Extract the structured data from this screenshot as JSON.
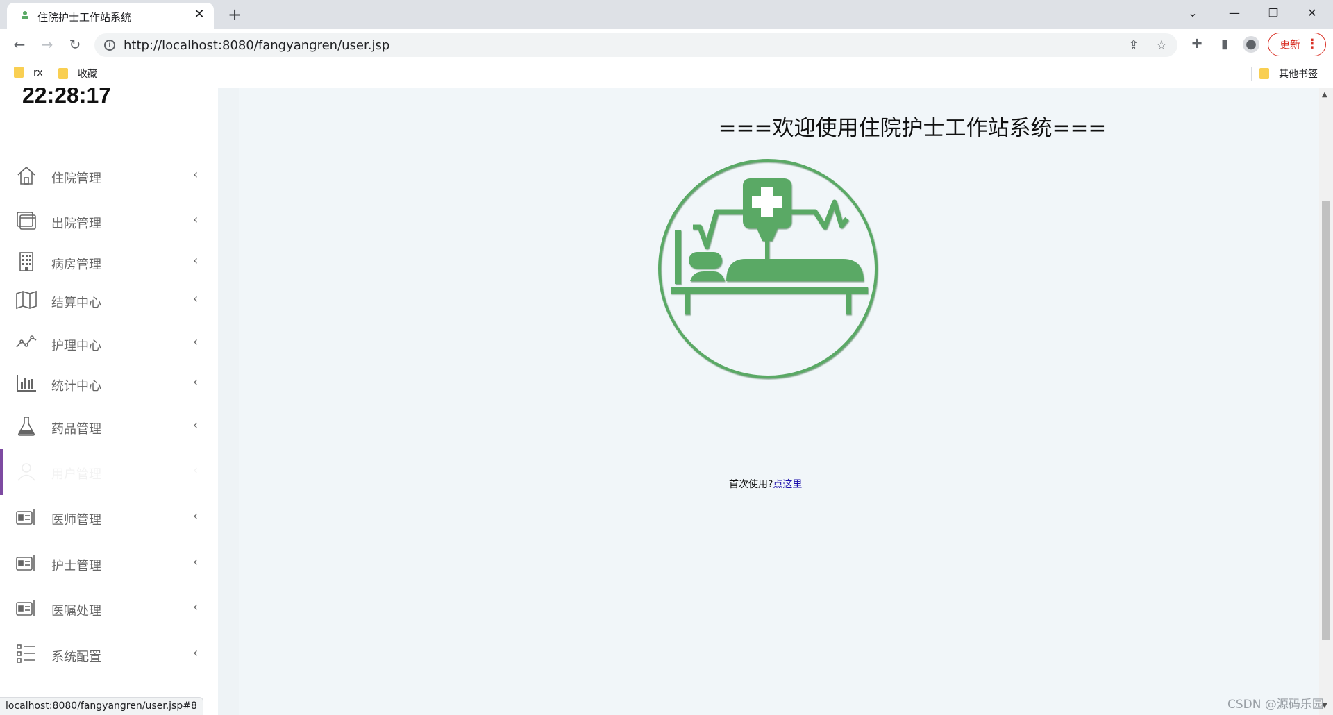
{
  "browser": {
    "tab_title": "住院护士工作站系统",
    "tab_close": "✕",
    "new_tab": "+",
    "url": "http://localhost:8080/fangyangren/user.jsp",
    "update_label": "更新",
    "bookmarks": [
      "rx",
      "收藏"
    ],
    "other_bookmarks": "其他书签",
    "status_url": "localhost:8080/fangyangren/user.jsp#8"
  },
  "sidebar": {
    "clock": "22:28:17",
    "items": [
      {
        "label": "住院管理",
        "icon": "home-icon"
      },
      {
        "label": "出院管理",
        "icon": "window-icon"
      },
      {
        "label": "病房管理",
        "icon": "building-icon"
      },
      {
        "label": "结算中心",
        "icon": "map-icon"
      },
      {
        "label": "护理中心",
        "icon": "line-chart-icon"
      },
      {
        "label": "统计中心",
        "icon": "bar-chart-icon"
      },
      {
        "label": "药品管理",
        "icon": "flask-icon"
      },
      {
        "label": "用户管理",
        "icon": "user-icon"
      },
      {
        "label": "医师管理",
        "icon": "id-card-icon"
      },
      {
        "label": "护士管理",
        "icon": "id-card-icon"
      },
      {
        "label": "医嘱处理",
        "icon": "id-card-icon"
      },
      {
        "label": "系统配置",
        "icon": "list-icon"
      }
    ],
    "active_index": 7,
    "active_color": "#7d4aa1"
  },
  "main": {
    "welcome_title": "===欢迎使用住院护士工作站系统===",
    "first_use_text": "首次使用?",
    "first_use_link": "点这里",
    "logo_color": "#5aa965"
  },
  "watermark": "CSDN @源码乐园"
}
